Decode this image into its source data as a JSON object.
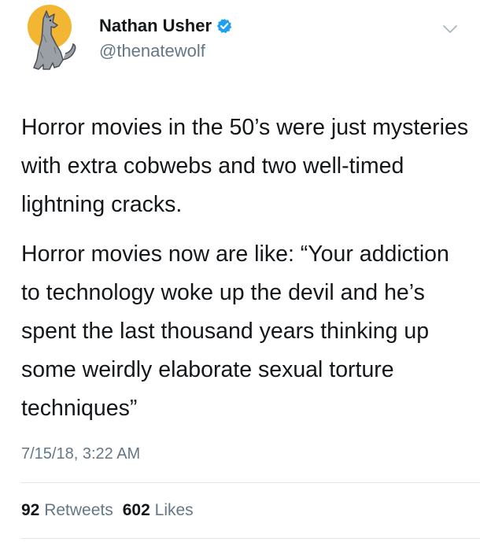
{
  "author": {
    "display_name": "Nathan Usher",
    "handle": "@thenatewolf",
    "verified": true
  },
  "tweet": {
    "paragraphs": [
      "Horror movies in the 50’s were just mysteries with extra cobwebs and two well-timed lightning cracks.",
      "Horror movies now are like: “Your addiction to technology woke up the devil and he’s spent the last thousand years thinking up some weirdly elaborate sexual torture techniques”"
    ],
    "timestamp": "7/15/18, 3:22 AM"
  },
  "stats": {
    "retweets_count": "92",
    "retweets_label": "Retweets",
    "likes_count": "602",
    "likes_label": "Likes"
  },
  "icons": {
    "avatar": "howling-wolf-moon-avatar",
    "verified": "verified-badge-icon",
    "menu": "chevron-down-icon"
  },
  "colors": {
    "verified_blue": "#1da1f2",
    "moon_yellow": "#f2b632",
    "muted_text": "#657786",
    "primary_text": "#14171a"
  }
}
